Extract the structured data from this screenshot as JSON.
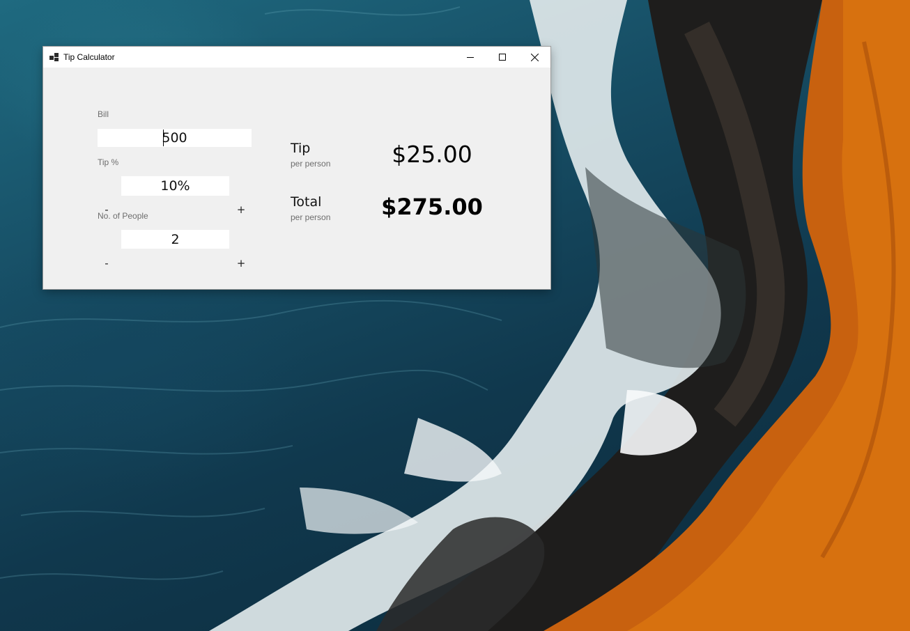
{
  "window": {
    "title": "Tip Calculator",
    "icon": "app-grid-icon",
    "controls": {
      "minimize": "minimize-icon",
      "maximize": "maximize-icon",
      "close": "close-icon"
    }
  },
  "form": {
    "bill_label": "Bill",
    "bill_value": "500",
    "tip_label": "Tip %",
    "tip_value": "10%",
    "people_label": "No. of People",
    "people_value": "2",
    "decrement_label": "-",
    "increment_label": "+"
  },
  "results": {
    "tip_label": "Tip",
    "tip_sub": "per person",
    "tip_value": "$25.00",
    "total_label": "Total",
    "total_sub": "per person",
    "total_value": "$275.00"
  },
  "colors": {
    "window_bg": "#f0f0f0",
    "titlebar_bg": "#ffffff",
    "label_gray": "#6d6d6d"
  }
}
